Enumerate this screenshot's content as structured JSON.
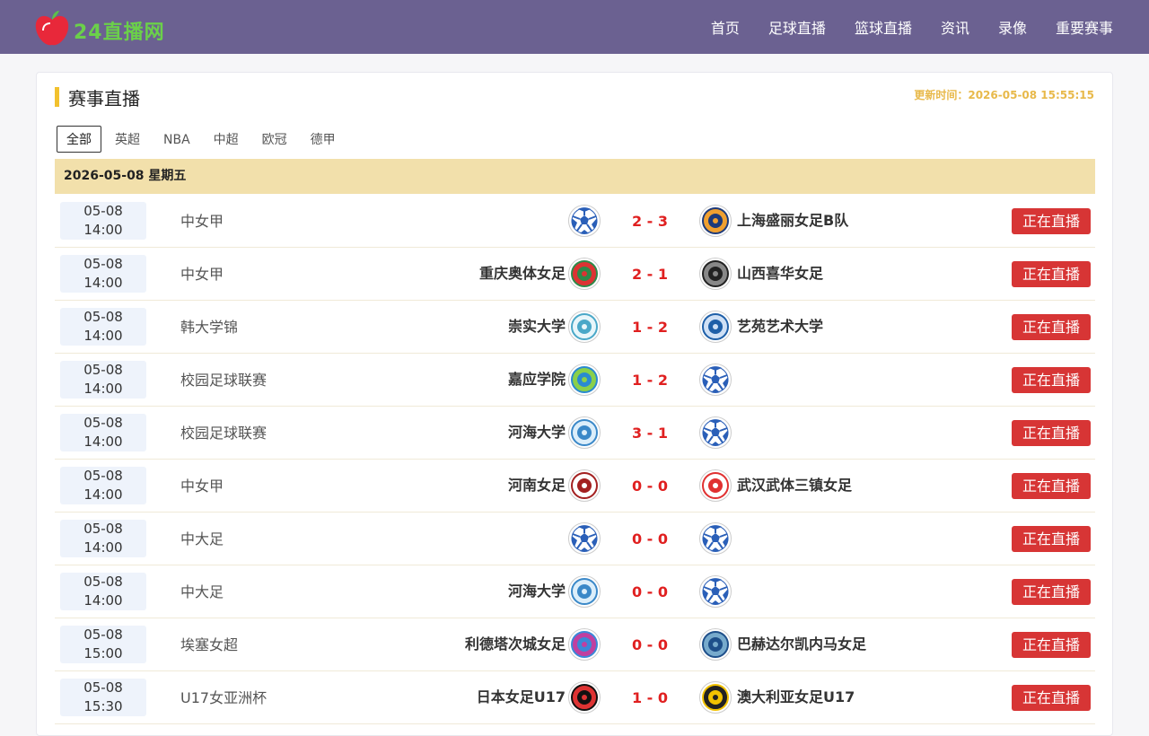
{
  "brand": {
    "logo_text": "24直播网"
  },
  "nav": [
    {
      "label": "首页"
    },
    {
      "label": "足球直播"
    },
    {
      "label": "篮球直播"
    },
    {
      "label": "资讯"
    },
    {
      "label": "录像"
    },
    {
      "label": "重要赛事"
    }
  ],
  "section": {
    "title": "赛事直播",
    "update_label": "更新时间：2026-05-08 15:55:15"
  },
  "tabs": [
    {
      "label": "全部",
      "active": true
    },
    {
      "label": "英超"
    },
    {
      "label": "NBA"
    },
    {
      "label": "中超"
    },
    {
      "label": "欧冠"
    },
    {
      "label": "德甲"
    }
  ],
  "date_header": "2026-05-08 星期五",
  "matches": [
    {
      "date": "05-08",
      "time": "14:00",
      "league": "中女甲",
      "home": "",
      "home_logo": "ball-icon",
      "score": "2 - 3",
      "away": "上海盛丽女足B队",
      "away_logo": "shanghai-shengli-logo",
      "status": "正在直播"
    },
    {
      "date": "05-08",
      "time": "14:00",
      "league": "中女甲",
      "home": "重庆奥体女足",
      "home_logo": "chongqing-aoti-logo",
      "score": "2 - 1",
      "away": "山西喜华女足",
      "away_logo": "shanxi-xihua-logo",
      "status": "正在直播"
    },
    {
      "date": "05-08",
      "time": "14:00",
      "league": "韩大学锦",
      "home": "崇实大学",
      "home_logo": "soongsil-logo",
      "score": "1 - 2",
      "away": "艺苑艺术大学",
      "away_logo": "yewon-logo",
      "status": "正在直播"
    },
    {
      "date": "05-08",
      "time": "14:00",
      "league": "校园足球联赛",
      "home": "嘉应学院",
      "home_logo": "jiaying-logo",
      "score": "1 - 2",
      "away": "",
      "away_logo": "ball-icon",
      "status": "正在直播"
    },
    {
      "date": "05-08",
      "time": "14:00",
      "league": "校园足球联赛",
      "home": "河海大学",
      "home_logo": "hohai-logo",
      "score": "3 - 1",
      "away": "",
      "away_logo": "ball-icon",
      "status": "正在直播"
    },
    {
      "date": "05-08",
      "time": "14:00",
      "league": "中女甲",
      "home": "河南女足",
      "home_logo": "henan-logo",
      "score": "0 - 0",
      "away": "武汉武体三镇女足",
      "away_logo": "wuhan-logo",
      "status": "正在直播"
    },
    {
      "date": "05-08",
      "time": "14:00",
      "league": "中大足",
      "home": "",
      "home_logo": "ball-icon",
      "score": "0 - 0",
      "away": "",
      "away_logo": "ball-icon",
      "status": "正在直播"
    },
    {
      "date": "05-08",
      "time": "14:00",
      "league": "中大足",
      "home": "河海大学",
      "home_logo": "hohai-logo",
      "score": "0 - 0",
      "away": "",
      "away_logo": "ball-icon",
      "status": "正在直播"
    },
    {
      "date": "05-08",
      "time": "15:00",
      "league": "埃塞女超",
      "home": "利德塔次城女足",
      "home_logo": "lideta-logo",
      "score": "0 - 0",
      "away": "巴赫达尔凯内马女足",
      "away_logo": "bahir-dar-logo",
      "status": "正在直播"
    },
    {
      "date": "05-08",
      "time": "15:30",
      "league": "U17女亚洲杯",
      "home": "日本女足U17",
      "home_logo": "japan-logo",
      "score": "1 - 0",
      "away": "澳大利亚女足U17",
      "away_logo": "australia-logo",
      "status": "正在直播"
    }
  ],
  "colors": {
    "topbar": "#6b6191",
    "accent": "#f2c12e",
    "date_header_bg": "#f2e0ab",
    "score": "#e02020",
    "live_button": "#d73535"
  }
}
